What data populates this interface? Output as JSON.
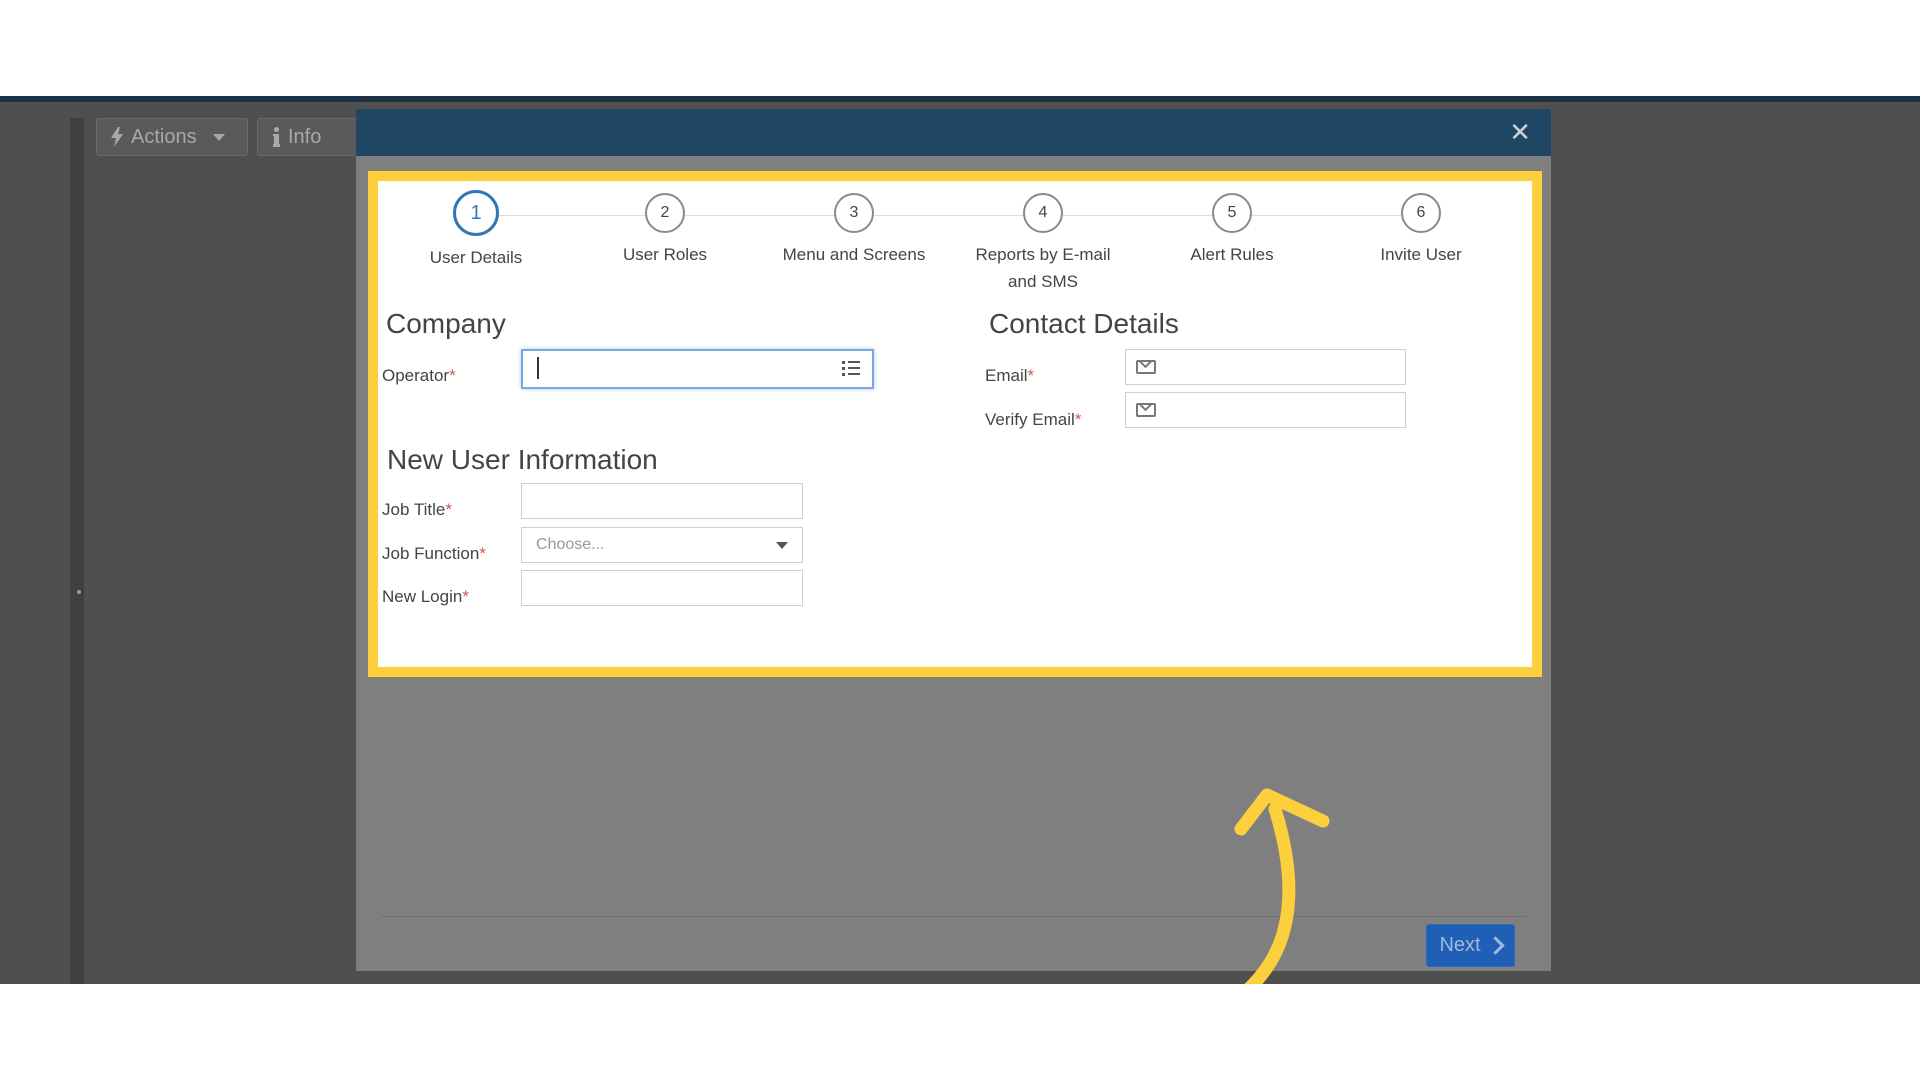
{
  "background": {
    "toolbar": {
      "actions_label": "Actions",
      "info_label": "Info"
    }
  },
  "modal": {
    "close_icon": "close-icon",
    "steps": [
      {
        "number": "1",
        "label": "User Details",
        "active": true
      },
      {
        "number": "2",
        "label": "User Roles",
        "active": false
      },
      {
        "number": "3",
        "label": "Menu and Screens",
        "active": false
      },
      {
        "number": "4",
        "label": "Reports by E-mail and SMS",
        "active": false
      },
      {
        "number": "5",
        "label": "Alert Rules",
        "active": false
      },
      {
        "number": "6",
        "label": "Invite User",
        "active": false
      }
    ],
    "company": {
      "title": "Company",
      "operator_label": "Operator",
      "operator_value": ""
    },
    "new_user": {
      "title": "New User Information",
      "job_title_label": "Job Title",
      "job_title_value": "",
      "job_function_label": "Job Function",
      "job_function_selected": "Choose...",
      "new_login_label": "New Login",
      "new_login_value": ""
    },
    "contact": {
      "title": "Contact Details",
      "email_label": "Email",
      "email_value": "",
      "verify_email_label": "Verify Email",
      "verify_email_value": ""
    },
    "required_marker": "*",
    "footer": {
      "next_label": "Next"
    }
  },
  "colors": {
    "highlight": "#fcd03c",
    "modal_header": "#1f4663",
    "active_step": "#3277b3",
    "next_button": "#1f5fb5",
    "required": "#d9534f"
  }
}
